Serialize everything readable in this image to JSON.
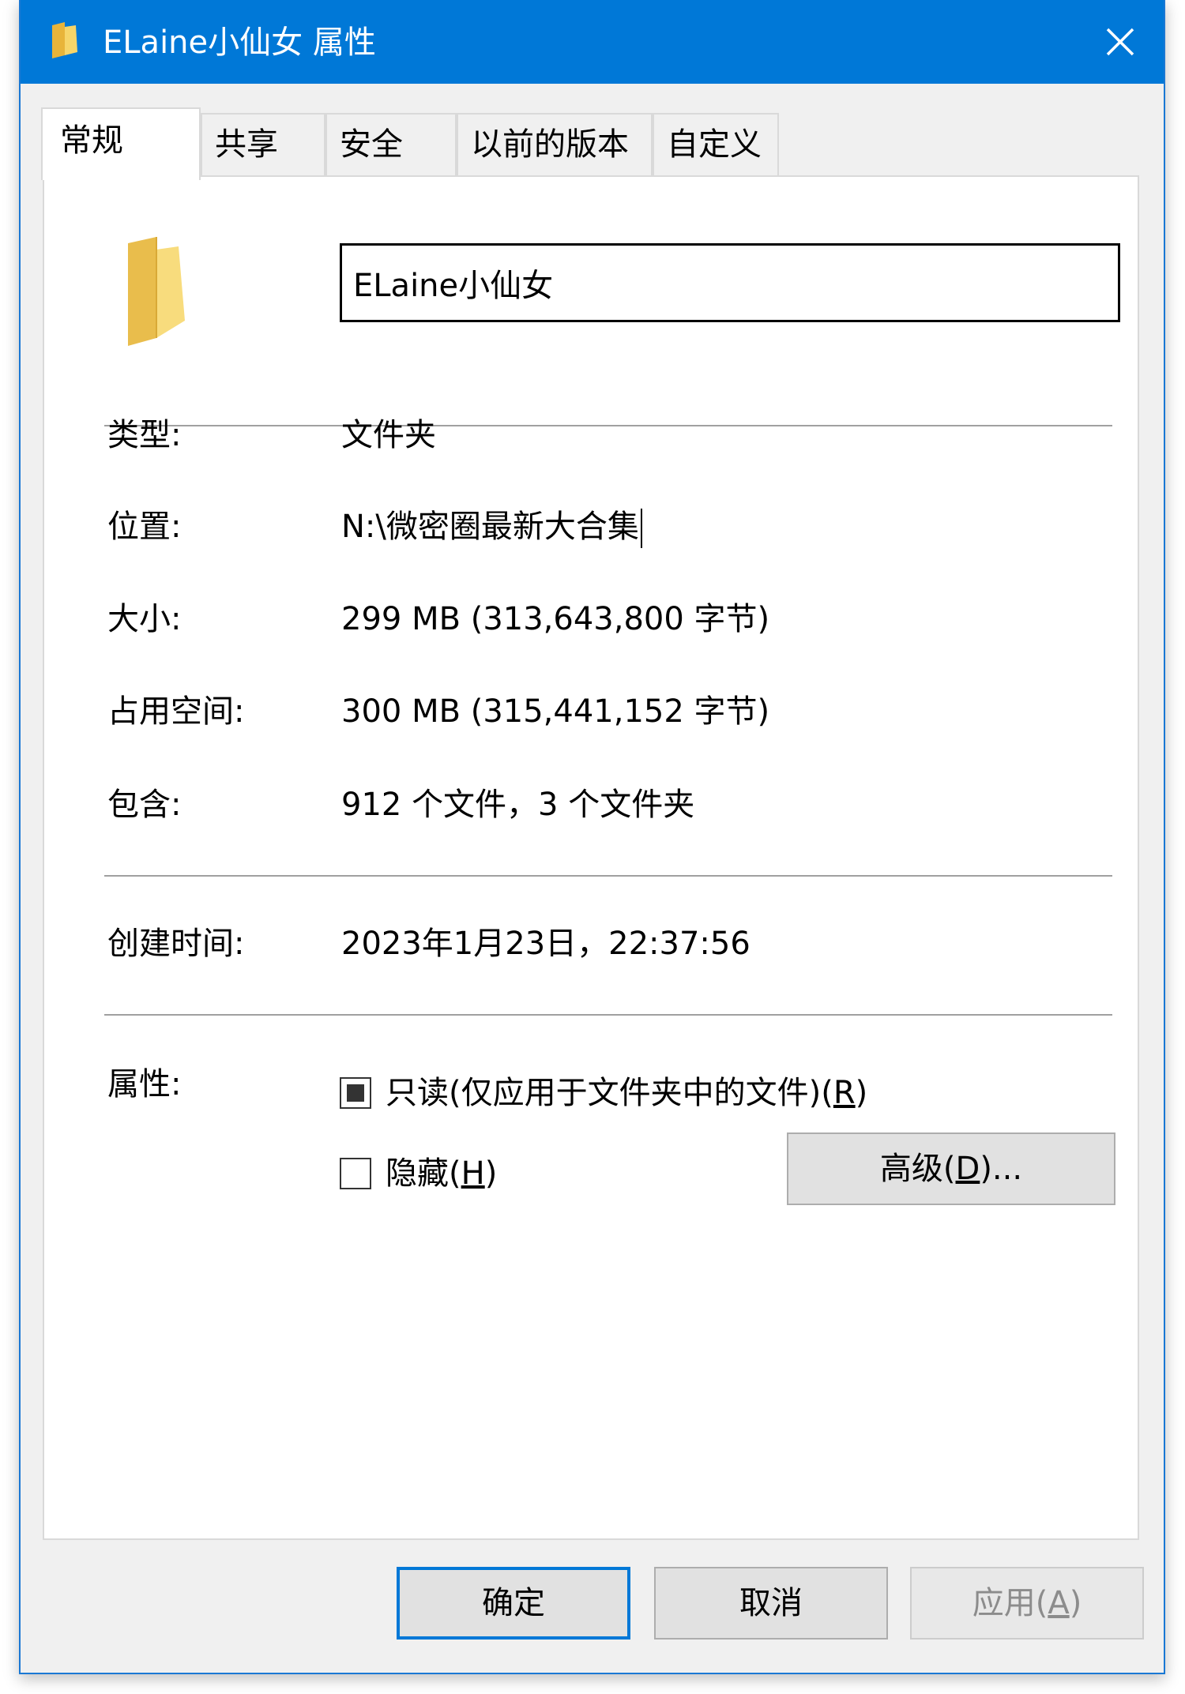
{
  "window": {
    "title": "ELaine小仙女 属性",
    "accent_color": "#0078d7"
  },
  "tabs": [
    {
      "label": "常规",
      "active": true
    },
    {
      "label": "共享",
      "active": false
    },
    {
      "label": "安全",
      "active": false
    },
    {
      "label": "以前的版本",
      "active": false
    },
    {
      "label": "自定义",
      "active": false
    }
  ],
  "general": {
    "folder_name": "ELaine小仙女",
    "type_label": "类型:",
    "type_value": "文件夹",
    "location_label": "位置:",
    "location_value": "N:\\微密圈最新大合集",
    "size_label": "大小:",
    "size_value": "299 MB (313,643,800 字节)",
    "size_on_disk_label": "占用空间:",
    "size_on_disk_value": "300 MB (315,441,152 字节)",
    "contains_label": "包含:",
    "contains_value": "912 个文件，3 个文件夹",
    "created_label": "创建时间:",
    "created_value": "2023年1月23日，22:37:56",
    "attributes_label": "属性:",
    "readonly_label_pre": "只读(仅应用于文件夹中的文件)(",
    "readonly_mnemonic": "R",
    "readonly_label_post": ")",
    "readonly_state": "indeterminate",
    "hidden_label_pre": "隐藏(",
    "hidden_mnemonic": "H",
    "hidden_label_post": ")",
    "hidden_checked": false,
    "advanced_pre": "高级(",
    "advanced_mnemonic": "D",
    "advanced_post": ")..."
  },
  "footer": {
    "ok_label": "确定",
    "cancel_label": "取消",
    "apply_pre": "应用(",
    "apply_mnemonic": "A",
    "apply_post": ")",
    "apply_disabled": true
  },
  "icons": {
    "title": "folder-icon",
    "close": "close-icon",
    "large": "folder-icon"
  }
}
